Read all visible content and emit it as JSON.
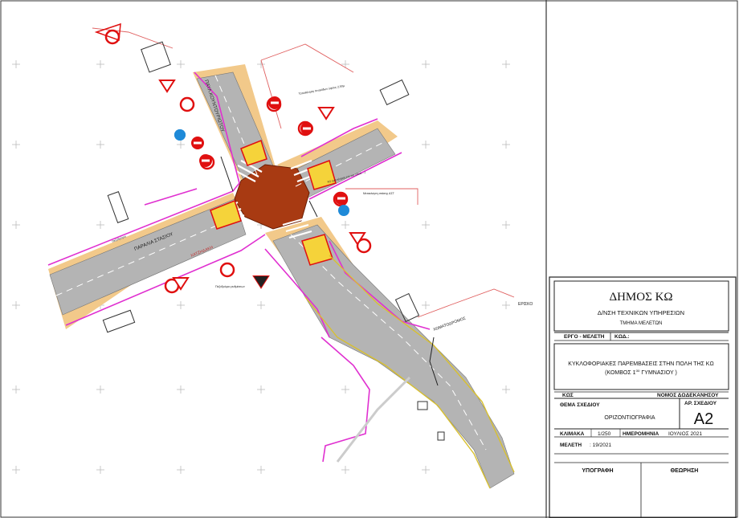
{
  "plan": {
    "street_labels": {
      "pavlou_kountourioti": "ΠΑΥΛ.ΚΟΥΝΤΟΥΡΙΩΤΟΥ",
      "paralia_stasiou": "ΠΑΡΑΛΙΑ ΣΤΑΣΙΟΥ",
      "xatzidaki": "ΧΑΤΖΗΔΑΚΗ",
      "chimatodromos": "ΧΩΜΑΤΟΔΡΟΜΟΣ",
      "erisko": "ΕΡΙΣΚΟ"
    },
    "small_notes": {
      "note_top": "Τοποθέτηση πινακίδων ύψους 2,50μ",
      "note_right": "Ρ2 (για κίνηση επί της οδού ...)",
      "note_right2": "Μετακίνηση στάσης ΑΣΤ",
      "note_left": "Πεζοδρόμιο",
      "note_bottom": "Πεζοδρόμιο ρυθμίσεων"
    },
    "colors": {
      "road_grey": "#b4b4b4",
      "sidewalk_tan": "#f2c98a",
      "intersection_brown": "#a83a12",
      "kerb_magenta": "#e030d0",
      "sign_red": "#e01010",
      "mandatory_blue": "#1f8ad8",
      "leader_red": "#e06060"
    }
  },
  "title_block": {
    "municipality": "ΔΗΜΟΣ ΚΩ",
    "directorate": "Δ/ΝΣΗ ΤΕΧΝΙΚΩΝ ΥΠΗΡΕΣΙΩΝ",
    "department": "ΤΜΗΜΑ  ΜΕΛΕΤΩΝ",
    "ergo_label": "ΕΡΓΟ  -  ΜΕΛΕΤΗ",
    "kod_label": "ΚΩΔ.:",
    "project_line1": "ΚΥΚΛΟΦΟΡΙΑΚΕΣ ΠΑΡΕΜΒΑΣΕΙΣ ΣΤΗΝ ΠΟΛΗ ΤΗΣ ΚΩ",
    "project_line2": "(ΚΟΜΒΟΣ 1",
    "project_sup": "ου",
    "project_line2_end": " ΓΥΜΝΑΣΙΟΥ )",
    "location_label": "ΚΩΣ",
    "prefecture": "ΝΟΜΟΣ  ΔΩΔΕΚΑΝΗΣΟΥ",
    "drawing_subject_label": "ΘΕΜΑ  ΣΧΕΔΙΟΥ",
    "drawing_subject": "ΟΡΙΖΟΝΤΙΟΓΡΑΦΙΑ",
    "drawing_no_label": "ΑΡ. ΣΧΕΔΙΟΥ",
    "drawing_no": "A2",
    "scale_label": "ΚΛΙΜΑΚΑ",
    "scale": "1/250",
    "date_label": "ΗΜΕΡΟΜΗΝΙΑ",
    "date": "ΙΟΥΛΙΟΣ 2021",
    "study_label": "ΜΕΛΕΤΗ",
    "study_value": ":  19/2021",
    "signed_label": "ΥΠΟΓΡΑΦΗ",
    "checked_label": "ΘΕΩΡΗΣΗ"
  }
}
